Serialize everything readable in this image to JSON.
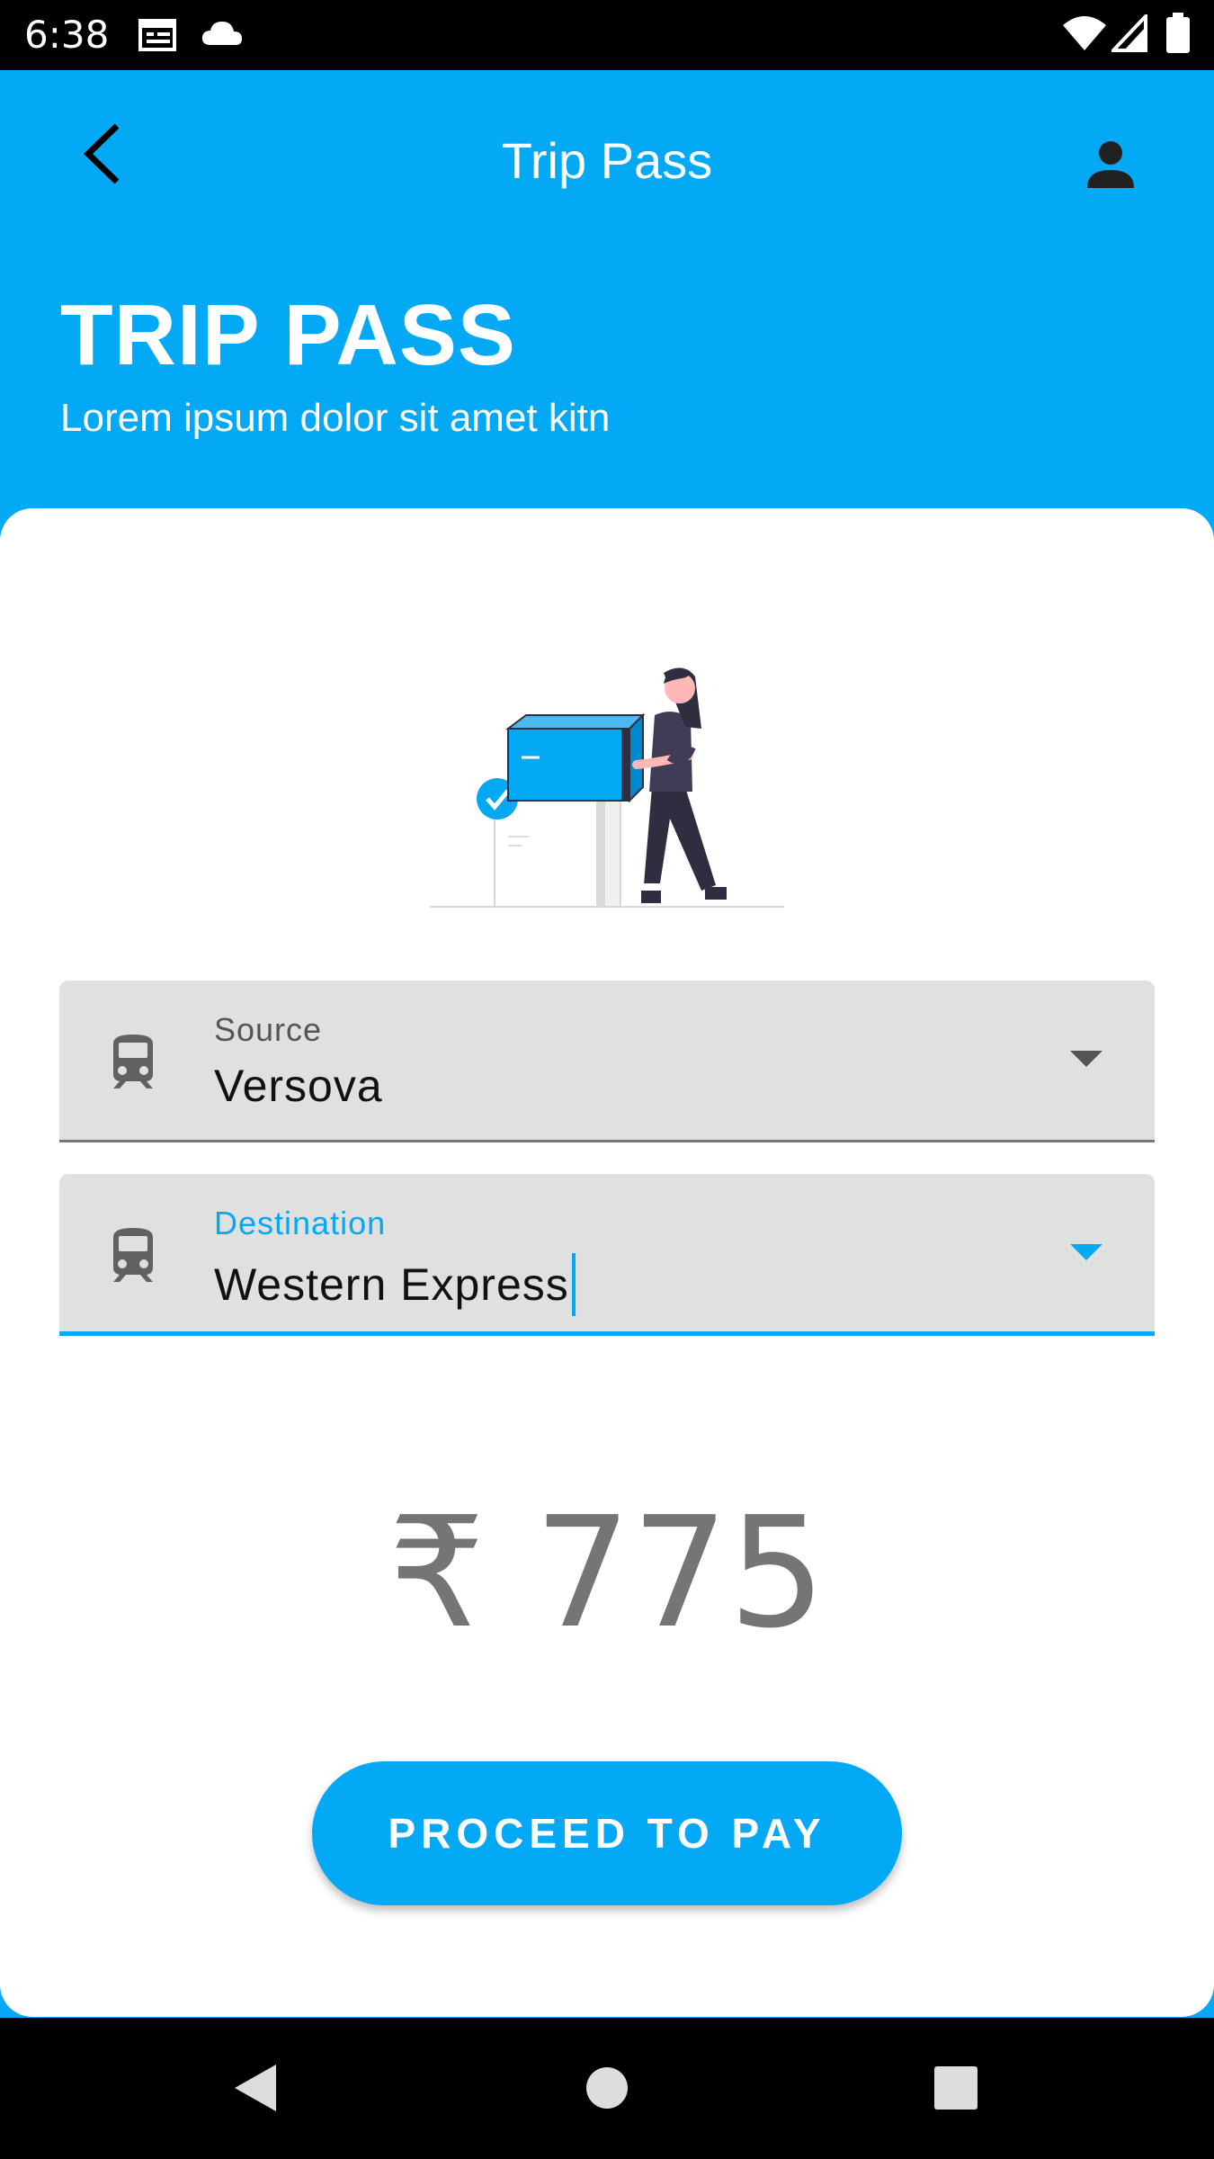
{
  "status_bar": {
    "time": "6:38",
    "icons": [
      "calendar-icon",
      "cloud-icon",
      "wifi-icon",
      "signal-icon",
      "battery-icon"
    ]
  },
  "app_bar": {
    "title": "Trip Pass",
    "back_icon": "back-arrow-icon",
    "profile_icon": "person-icon"
  },
  "hero": {
    "title": "TRIP PASS",
    "subtitle": "Lorem ipsum dolor sit amet kitn"
  },
  "form": {
    "source": {
      "label": "Source",
      "value": "Versova",
      "icon": "train-icon"
    },
    "destination": {
      "label": "Destination",
      "value": "Western Express",
      "icon": "train-icon"
    }
  },
  "price": "₹ 775",
  "pay_button": "PROCEED TO PAY",
  "colors": {
    "primary": "#03A9F4",
    "card": "#FFFFFF",
    "field_bg": "#E0E0E0",
    "price_text": "#757575"
  },
  "nav_bar": {
    "icons": [
      "nav-back-icon",
      "nav-home-icon",
      "nav-recents-icon"
    ]
  }
}
